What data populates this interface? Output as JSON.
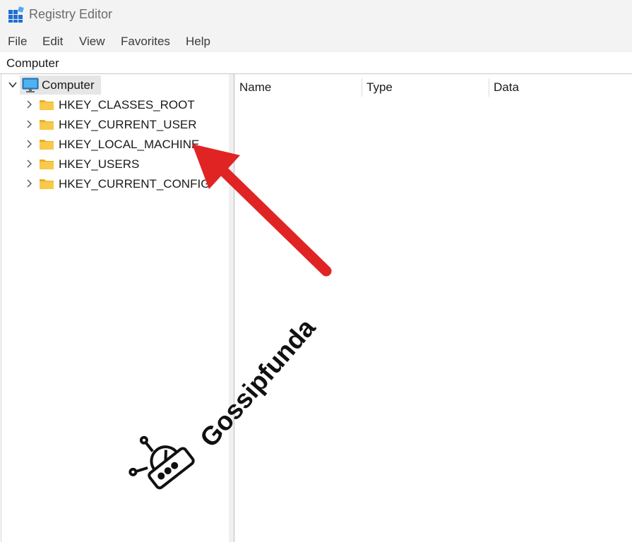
{
  "window": {
    "title": "Registry Editor",
    "icon": "registry-editor-icon"
  },
  "menu": {
    "items": [
      {
        "label": "File"
      },
      {
        "label": "Edit"
      },
      {
        "label": "View"
      },
      {
        "label": "Favorites"
      },
      {
        "label": "Help"
      }
    ]
  },
  "address": {
    "path": "Computer"
  },
  "tree": {
    "root": {
      "label": "Computer",
      "icon": "computer-icon",
      "expanded": true
    },
    "items": [
      {
        "label": "HKEY_CLASSES_ROOT",
        "icon": "folder-icon"
      },
      {
        "label": "HKEY_CURRENT_USER",
        "icon": "folder-icon"
      },
      {
        "label": "HKEY_LOCAL_MACHINE",
        "icon": "folder-icon"
      },
      {
        "label": "HKEY_USERS",
        "icon": "folder-icon"
      },
      {
        "label": "HKEY_CURRENT_CONFIG",
        "icon": "folder-icon"
      }
    ]
  },
  "list": {
    "columns": [
      {
        "label": "Name"
      },
      {
        "label": "Type"
      },
      {
        "label": "Data"
      }
    ]
  },
  "watermark": {
    "text": "Gossipfunda"
  },
  "colors": {
    "folder": "#f8c94a",
    "folder_dark": "#e8ad1f",
    "arrow": "#e02424",
    "selection": "#e6e6e6"
  }
}
